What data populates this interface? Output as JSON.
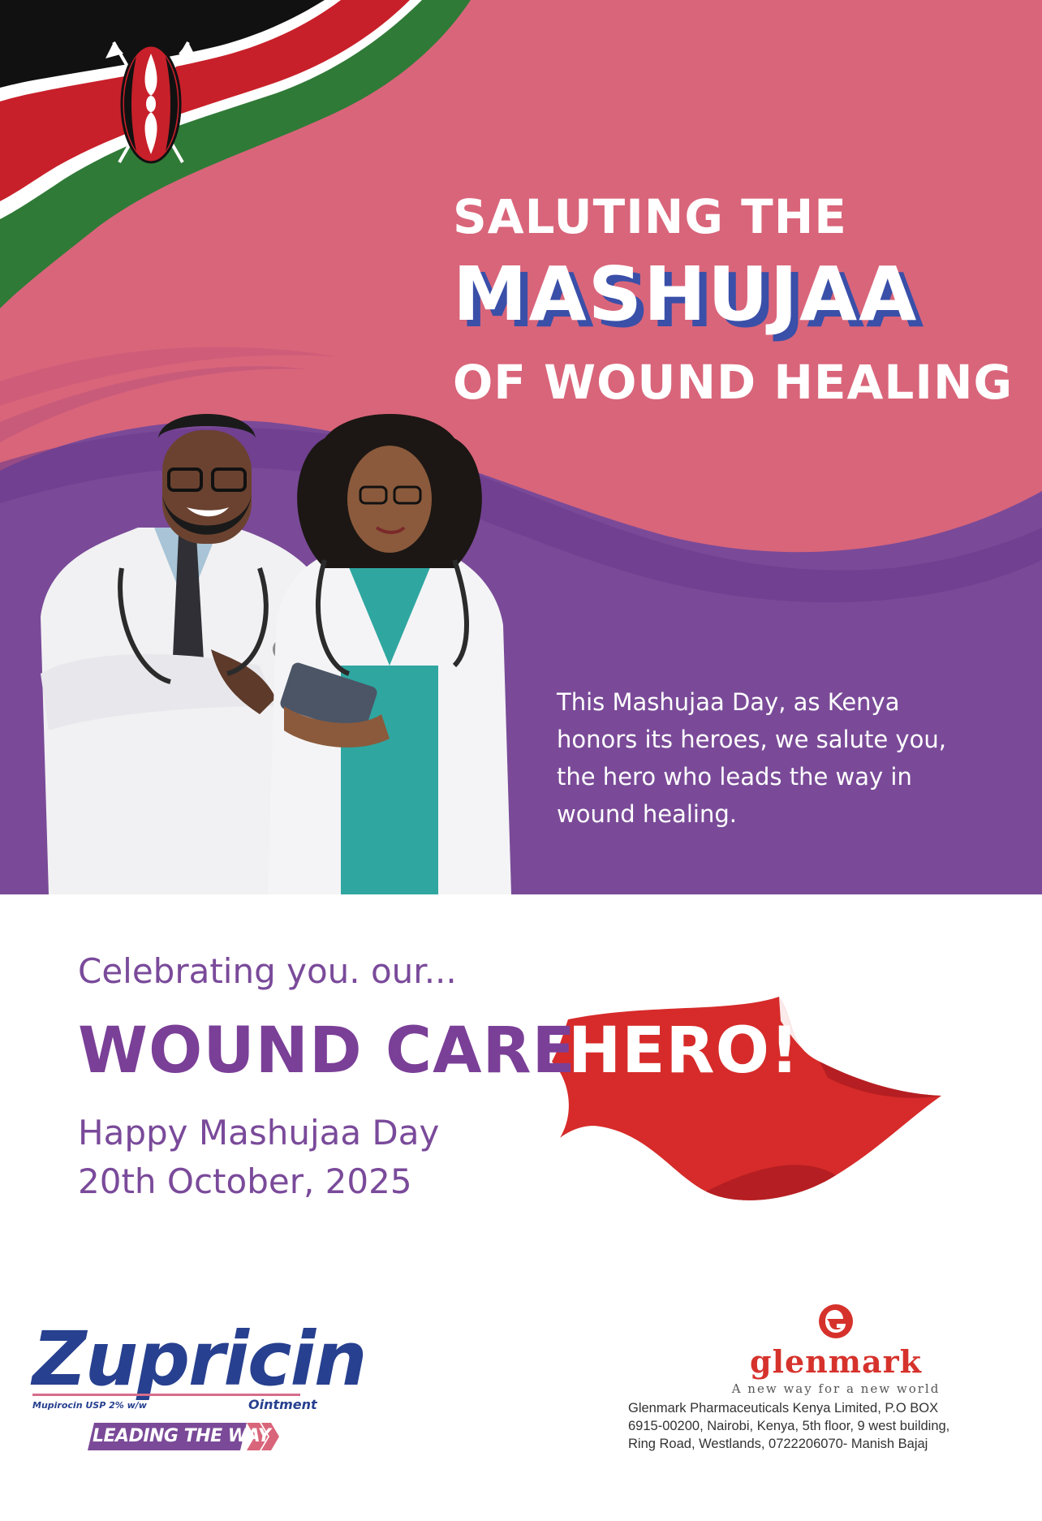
{
  "headline": {
    "line1": "SALUTING THE",
    "line2": "MASHUJAA",
    "line3": "OF WOUND HEALING"
  },
  "message": {
    "line1": "This Mashujaa Day, as Kenya",
    "line2": "honors its heroes, we salute you,",
    "line3": "the hero who leads the way in",
    "line4": "wound healing."
  },
  "celebration": {
    "intro": "Celebrating you. our...",
    "title_part1": "WOUND CARE",
    "title_part2": "HERO!",
    "greeting": "Happy Mashujaa Day",
    "date": "20th October, 2025"
  },
  "product": {
    "name": "Zupricin",
    "subtitle": "Mupirocin USP 2% w/w",
    "form": "Ointment",
    "tagline": "LEADING THE WAY"
  },
  "company": {
    "name": "Glenmark",
    "tagline": "A new way for a new world",
    "address_line1": "Glenmark Pharmaceuticals Kenya Limited, P.O BOX",
    "address_line2": "6915-00200, Nairobi, Kenya, 5th floor, 9 west building,",
    "address_line3": "Ring Road, Westlands, 0722206070- Manish Bajaj"
  },
  "colors": {
    "pink": "#d9657a",
    "purple": "#7a4a98",
    "flag_red": "#c8202a",
    "flag_green": "#2f7a37",
    "brand_blue": "#27408f",
    "glenmark_red": "#d6322c"
  }
}
